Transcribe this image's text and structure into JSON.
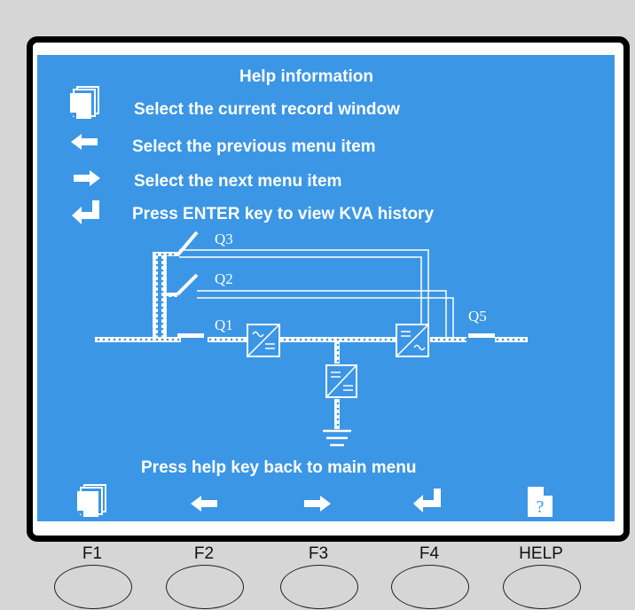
{
  "screen": {
    "title": "Help information",
    "help_items": [
      {
        "icon": "record-window-icon",
        "text": "Select the current record window"
      },
      {
        "icon": "left-arrow-icon",
        "text": "Select the previous menu item"
      },
      {
        "icon": "right-arrow-icon",
        "text": "Select the next menu item"
      },
      {
        "icon": "enter-icon",
        "text": "Press ENTER key to view KVA history"
      }
    ],
    "footer_text": "Press help key back to main menu",
    "help_glyph": "?"
  },
  "diagram": {
    "labels": {
      "q1": "Q1",
      "q2": "Q2",
      "q3": "Q3",
      "q5": "Q5"
    }
  },
  "keys": [
    {
      "label": "F1"
    },
    {
      "label": "F2"
    },
    {
      "label": "F3"
    },
    {
      "label": "F4"
    },
    {
      "label": "HELP"
    }
  ],
  "colors": {
    "screen_bg": "#3b96e6",
    "panel_bg": "#d6d6d6",
    "text": "#ffffff"
  }
}
